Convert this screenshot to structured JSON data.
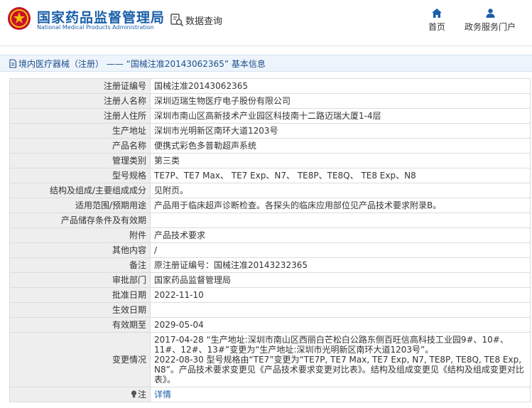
{
  "header": {
    "site_name_cn": "国家药品监督管理局",
    "site_name_en": "National Medical Products Administration",
    "search_label": "数据查询",
    "nav": [
      {
        "label": "首页",
        "icon": "home-icon"
      },
      {
        "label": "政务服务门户",
        "icon": "user-icon"
      }
    ]
  },
  "breadcrumb": {
    "text": "境内医疗器械（注册） —— “国械注准20143062365” 基本信息"
  },
  "rows": [
    {
      "label": "注册证编号",
      "value": "国械注准20143062365"
    },
    {
      "label": "注册人名称",
      "value": "深圳迈瑞生物医疗电子股份有限公司"
    },
    {
      "label": "注册人住所",
      "value": "深圳市南山区高新技术产业园区科技南十二路迈瑞大厦1-4层"
    },
    {
      "label": "生产地址",
      "value": "深圳市光明新区南环大道1203号"
    },
    {
      "label": "产品名称",
      "value": "便携式彩色多普勒超声系统"
    },
    {
      "label": "管理类别",
      "value": "第三类"
    },
    {
      "label": "型号规格",
      "value": "TE7P、TE7 Max、 TE7 Exp、N7、 TE8P、TE8Q、 TE8 Exp、N8"
    },
    {
      "label": "结构及组成/主要组成成分",
      "value": "见附页。"
    },
    {
      "label": "适用范围/预期用途",
      "value": "产品用于临床超声诊断检查。各探头的临床应用部位见产品技术要求附录B。"
    },
    {
      "label": "产品储存条件及有效期",
      "value": ""
    },
    {
      "label": "附件",
      "value": "产品技术要求"
    },
    {
      "label": "其他内容",
      "value": "/"
    },
    {
      "label": "备注",
      "value": "原注册证编号：国械注准20143232365"
    },
    {
      "label": "审批部门",
      "value": "国家药品监督管理局"
    },
    {
      "label": "批准日期",
      "value": "2022-11-10"
    },
    {
      "label": "生效日期",
      "value": ""
    },
    {
      "label": "有效期至",
      "value": "2029-05-04"
    }
  ],
  "changes": {
    "label": "变更情况",
    "lines": [
      "2017-04-28 “生产地址:深圳市南山区西丽白芒松白公路东侧百旺信高科技工业园9#、10#、11#、12#、13#”变更为“生产地址:深圳市光明新区南环大道1203号”。",
      "2022-08-30 型号规格由“TE7”变更为“TE7P, TE7 Max, TE7 Exp, N7, TE8P, TE8Q, TE8 Exp, N8”。产品技术要求变更见《产品技术要求变更对比表》。结构及组成变更见《结构及组成变更对比表》。"
    ]
  },
  "note": {
    "label": "注",
    "link_text": "详情"
  }
}
